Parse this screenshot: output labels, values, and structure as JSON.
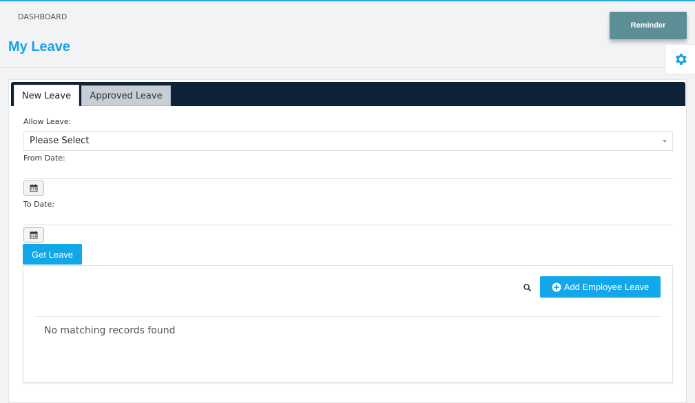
{
  "breadcrumb": "DASHBOARD",
  "page_title": "My Leave",
  "reminder_label": "Reminder",
  "tabs": [
    {
      "label": "New Leave",
      "active": true
    },
    {
      "label": "Approved Leave",
      "active": false
    }
  ],
  "form": {
    "allow_leave_label": "Allow Leave:",
    "allow_leave_value": "Please Select",
    "from_date_label": "From Date:",
    "from_date_value": "",
    "to_date_label": "To Date:",
    "to_date_value": "",
    "get_leave_label": "Get Leave"
  },
  "table": {
    "add_button_label": "Add Employee Leave",
    "empty_message": "No matching records found"
  },
  "icons": {
    "settings": "gear-icon",
    "calendar": "calendar-icon",
    "search": "search-icon",
    "add": "plus-circle-icon"
  },
  "colors": {
    "accent": "#1ba1e2",
    "button_blue": "#12a7e8",
    "tabbar_navy": "#0e2238",
    "reminder_teal": "#5b8e95"
  }
}
